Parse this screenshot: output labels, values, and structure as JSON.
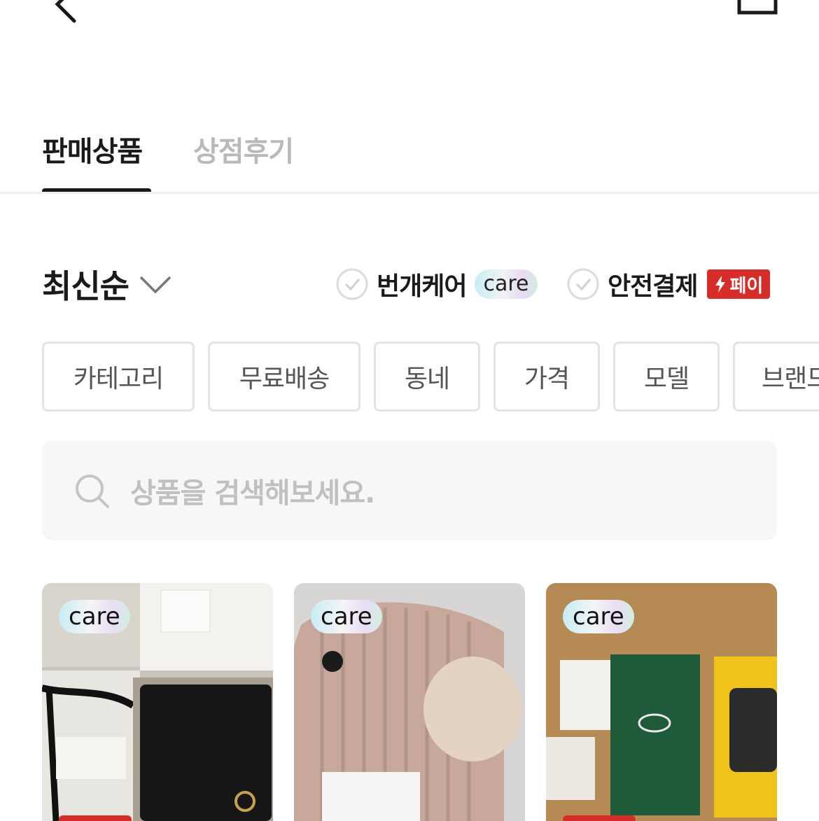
{
  "tabs": {
    "active": "판매상품",
    "inactive": "상점후기"
  },
  "sort": {
    "label": "최신순"
  },
  "filters": {
    "care": {
      "label": "번개케어",
      "badge": "care"
    },
    "safe_pay": {
      "label": "안전결제",
      "badge": "페이"
    }
  },
  "chips": [
    "카테고리",
    "무료배송",
    "동네",
    "가격",
    "모델",
    "브랜드"
  ],
  "search": {
    "placeholder": "상품을 검색해보세요."
  },
  "products": [
    {
      "badge": "care"
    },
    {
      "badge": "care"
    },
    {
      "badge": "care"
    }
  ],
  "colors": {
    "accent_red": "#d72d2a",
    "text_dark": "#1a1a1a",
    "text_muted": "#b9b9b9"
  },
  "icons": [
    "back-arrow-icon",
    "share-icon",
    "chevron-down-icon",
    "check-circle-icon",
    "lightning-icon",
    "search-icon"
  ]
}
